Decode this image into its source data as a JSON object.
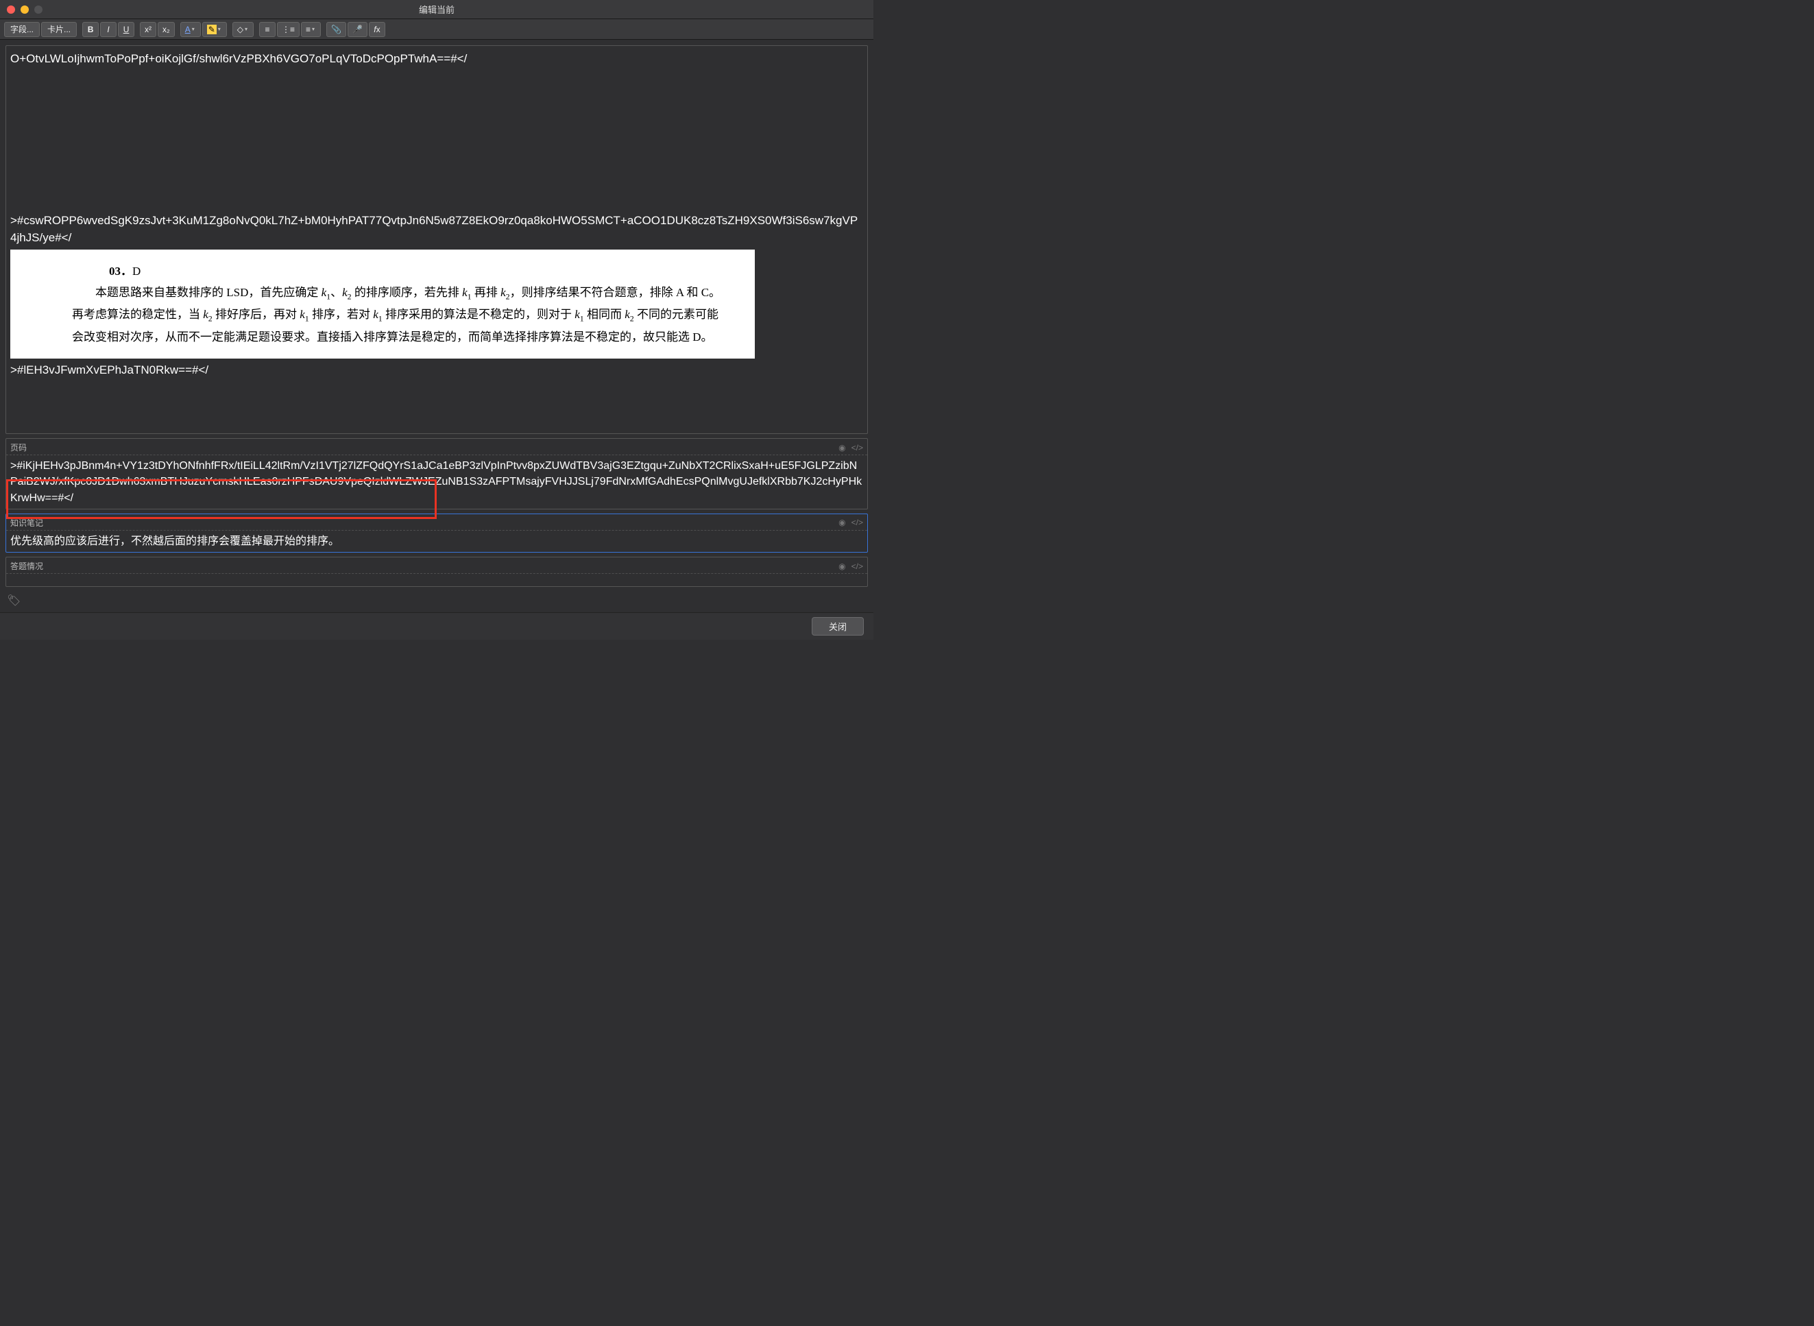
{
  "window": {
    "title": "编辑当前"
  },
  "toolbar": {
    "fields_btn": "字段...",
    "cards_btn": "卡片..."
  },
  "main": {
    "top_truncated": "O+OtvLWLoIjhwmToPoPpf+oiKojlGf/shwl6rVzPBXh6VGO7oPLqVToDcPOpPTwhA==#</",
    "hash_block1": ">#cswROPP6wvedSgK9zsJvt+3KuM1Zg8oNvQ0kL7hZ+bM0HyhPAT77QvtpJn6N5w87Z8EkO9rz0qa8koHWO5SMCT+aCOO1DUK8cz8TsZH9XS0Wf3iS6sw7kgVP4jhJS/ye#</",
    "explanation": {
      "qnum": "03．",
      "answer": "D",
      "body": "本题思路来自基数排序的 LSD，首先应确定 k₁、k₂ 的排序顺序，若先排 k₁ 再排 k₂，则排序结果不符合题意，排除 A 和 C。再考虑算法的稳定性，当 k₂ 排好序后，再对 k₁ 排序，若对 k₁ 排序采用的算法是不稳定的，则对于 k₁ 相同而 k₂ 不同的元素可能会改变相对次序，从而不一定能满足题设要求。直接插入排序算法是稳定的，而简单选择排序算法是不稳定的，故只能选 D。"
    },
    "hash_block2": ">#lEH3vJFwmXvEPhJaTN0Rkw==#</"
  },
  "page_field": {
    "label": "页码",
    "value": ">#iKjHEHv3pJBnm4n+VY1z3tDYhONfnhfFRx/tIEiLL42ltRm/VzI1VTj27lZFQdQYrS1aJCa1eBP3zlVpInPtvv8pxZUWdTBV3ajG3EZtgqu+ZuNbXT2CRlixSxaH+uE5FJGLPZzibNPaiB2WJ/xfKpc0JD1Dwh63xmBTHJuzuYcrnskHLEas0rzHPFsDAU9VpeQIzldWLZWJEZuNB1S3zAFPTMsajyFVHJJSLj79FdNrxMfGAdhEcsPQnlMvgUJefklXRbb7KJ2cHyPHkKrwHw==#</"
  },
  "notes_field": {
    "label": "知识笔记",
    "value": "优先级高的应该后进行，不然越后面的排序会覆盖掉最开始的排序。"
  },
  "answer_field": {
    "label": "答题情况",
    "value": ""
  },
  "footer": {
    "close": "关闭"
  }
}
